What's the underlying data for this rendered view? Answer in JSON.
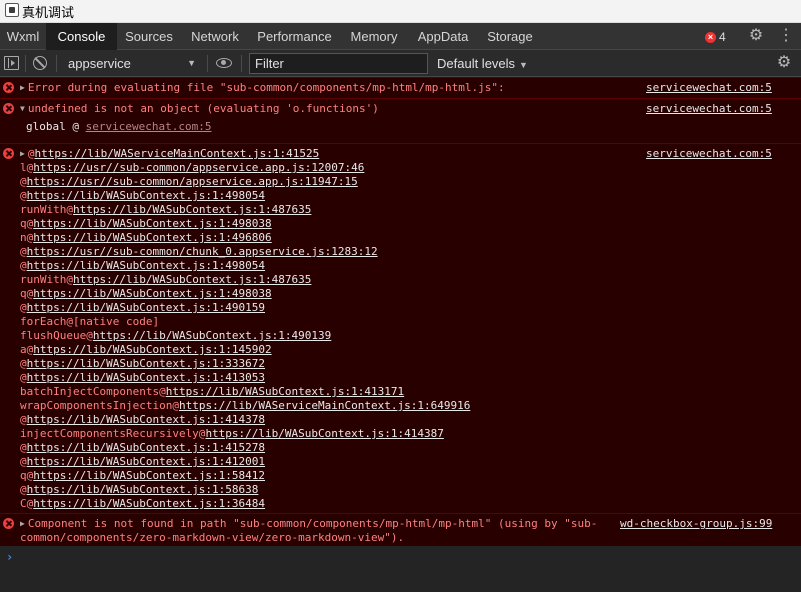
{
  "window": {
    "title": "真机调试"
  },
  "tabs": [
    {
      "label": "Wxml",
      "active": false
    },
    {
      "label": "Console",
      "active": true
    },
    {
      "label": "Sources",
      "active": false
    },
    {
      "label": "Network",
      "active": false
    },
    {
      "label": "Performance",
      "active": false
    },
    {
      "label": "Memory",
      "active": false
    },
    {
      "label": "AppData",
      "active": false
    },
    {
      "label": "Storage",
      "active": false
    }
  ],
  "error_badge": {
    "count": "4",
    "color": "#e33333"
  },
  "toolbar": {
    "context": "appservice",
    "filter_placeholder": "Filter",
    "levels": "Default levels"
  },
  "messages": [
    {
      "text": "Error during evaluating file \"sub-common/components/mp-html/mp-html.js\":",
      "source": "servicewechat.com:5"
    },
    {
      "text": "undefined is not an object (evaluating 'o.functions')",
      "source": "servicewechat.com:5",
      "global_label": "global @ ",
      "global_url": "servicewechat.com:5"
    },
    {
      "source": "servicewechat.com:5",
      "stack": [
        {
          "fn": "@",
          "url": "https://lib/WAServiceMainContext.js:1:41525"
        },
        {
          "fn": "l@",
          "url": "https://usr//sub-common/appservice.app.js:12007:46"
        },
        {
          "fn": "@",
          "url": "https://usr//sub-common/appservice.app.js:11947:15"
        },
        {
          "fn": "@",
          "url": "https://lib/WASubContext.js:1:498054"
        },
        {
          "fn": "runWith@",
          "url": "https://lib/WASubContext.js:1:487635"
        },
        {
          "fn": "q@",
          "url": "https://lib/WASubContext.js:1:498038"
        },
        {
          "fn": "n@",
          "url": "https://lib/WASubContext.js:1:496806"
        },
        {
          "fn": "@",
          "url": "https://usr//sub-common/chunk_0.appservice.js:1283:12"
        },
        {
          "fn": "@",
          "url": "https://lib/WASubContext.js:1:498054"
        },
        {
          "fn": "runWith@",
          "url": "https://lib/WASubContext.js:1:487635"
        },
        {
          "fn": "q@",
          "url": "https://lib/WASubContext.js:1:498038"
        },
        {
          "fn": "@",
          "url": "https://lib/WASubContext.js:1:490159"
        },
        {
          "fn": "forEach@[native code]",
          "url": ""
        },
        {
          "fn": "flushQueue@",
          "url": "https://lib/WASubContext.js:1:490139"
        },
        {
          "fn": "a@",
          "url": "https://lib/WASubContext.js:1:145902"
        },
        {
          "fn": "@",
          "url": "https://lib/WASubContext.js:1:333672"
        },
        {
          "fn": "@",
          "url": "https://lib/WASubContext.js:1:413053"
        },
        {
          "fn": "batchInjectComponents@",
          "url": "https://lib/WASubContext.js:1:413171"
        },
        {
          "fn": "wrapComponentsInjection@",
          "url": "https://lib/WAServiceMainContext.js:1:649916"
        },
        {
          "fn": "@",
          "url": "https://lib/WASubContext.js:1:414378"
        },
        {
          "fn": "injectComponentsRecursively@",
          "url": "https://lib/WASubContext.js:1:414387"
        },
        {
          "fn": "@",
          "url": "https://lib/WASubContext.js:1:415278"
        },
        {
          "fn": "@",
          "url": "https://lib/WASubContext.js:1:412001"
        },
        {
          "fn": "q@",
          "url": "https://lib/WASubContext.js:1:58412"
        },
        {
          "fn": "@",
          "url": "https://lib/WASubContext.js:1:58638"
        },
        {
          "fn": "C@",
          "url": "https://lib/WASubContext.js:1:36484"
        }
      ]
    },
    {
      "text_line1": "Component is not found in path \"sub-common/components/mp-html/mp-html\" (using by \"sub-",
      "text_line2": "common/components/zero-markdown-view/zero-markdown-view\").",
      "source": "wd-checkbox-group.js:99"
    }
  ]
}
